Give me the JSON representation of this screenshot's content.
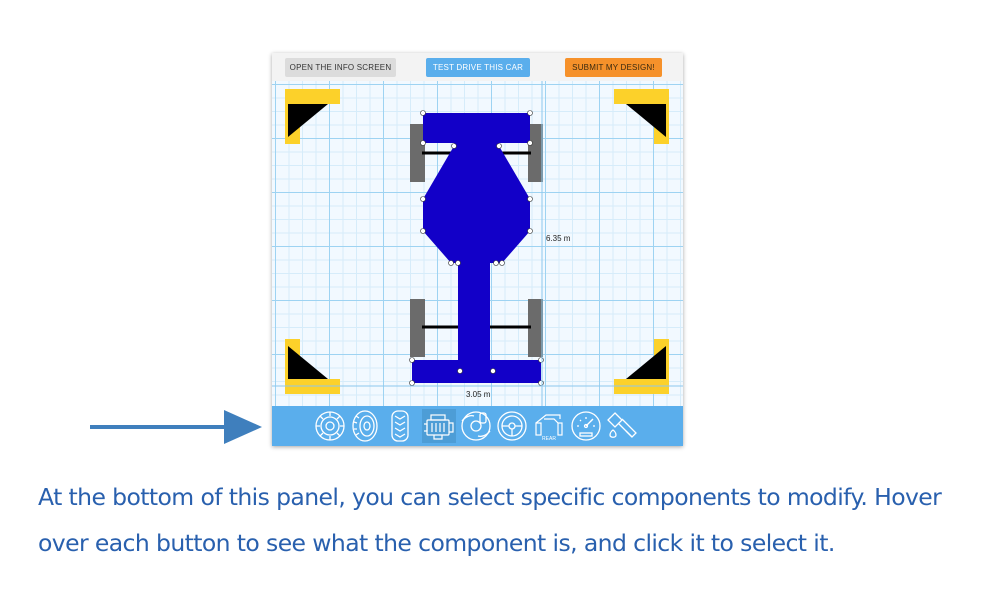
{
  "toolbar": {
    "info_label": "OPEN THE INFO SCREEN",
    "test_drive_label": "TEST DRIVE THIS CAR",
    "submit_label": "SUBMIT MY DESIGN!"
  },
  "canvas": {
    "length_label": "6.35 m",
    "width_label": "3.05 m"
  },
  "components": [
    {
      "icon": "tire-front-icon"
    },
    {
      "icon": "tire-side-icon"
    },
    {
      "icon": "tire-tread-icon"
    },
    {
      "icon": "engine-icon"
    },
    {
      "icon": "brake-disc-icon"
    },
    {
      "icon": "steering-wheel-icon"
    },
    {
      "icon": "rear-wing-icon",
      "label": "REAR"
    },
    {
      "icon": "speedometer-icon"
    },
    {
      "icon": "paint-icon"
    }
  ],
  "colors": {
    "car_body": "#1200c8",
    "tire": "#6b6b6b",
    "corner_marker": "#fcd12a",
    "component_bar": "#5aaeec",
    "caption": "#2960ae",
    "arrow": "#3f7fbd"
  },
  "caption": "At the bottom of this panel, you can select specific components to modify. Hover over each button to see what the component is, and click it to select it."
}
